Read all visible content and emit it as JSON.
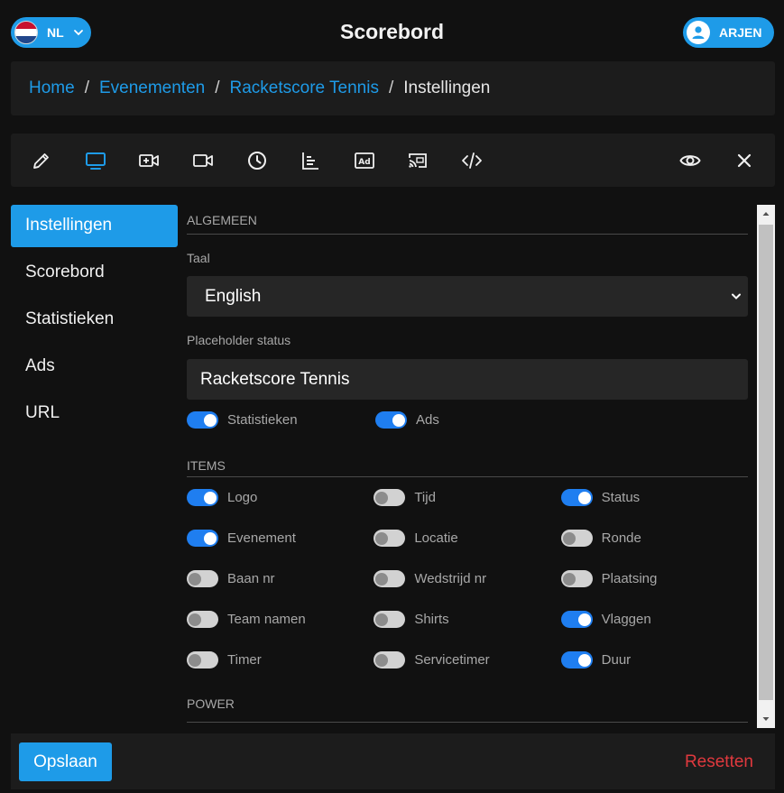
{
  "header": {
    "language": "NL",
    "title": "Scorebord",
    "user": "ARJEN"
  },
  "breadcrumb": {
    "items": [
      "Home",
      "Evenementen",
      "Racketscore Tennis"
    ],
    "current": "Instellingen",
    "separator": "/"
  },
  "toolbar": {
    "icons": [
      "pencil-icon",
      "monitor-icon",
      "video-add-icon",
      "video-icon",
      "clock-icon",
      "bar-chart-icon",
      "ad-icon",
      "cast-icon",
      "code-icon",
      "eye-icon",
      "close-icon"
    ],
    "active": "monitor-icon"
  },
  "sidenav": {
    "items": [
      "Instellingen",
      "Scorebord",
      "Statistieken",
      "Ads",
      "URL"
    ],
    "active": "Instellingen"
  },
  "settings": {
    "general_heading": "ALGEMEEN",
    "language_label": "Taal",
    "language_value": "English",
    "placeholder_label": "Placeholder status",
    "placeholder_value": "Racketscore Tennis",
    "general_toggles": [
      {
        "label": "Statistieken",
        "on": true
      },
      {
        "label": "Ads",
        "on": true
      }
    ],
    "items_heading": "ITEMS",
    "item_toggles": [
      {
        "label": "Logo",
        "on": true
      },
      {
        "label": "Tijd",
        "on": false
      },
      {
        "label": "Status",
        "on": true
      },
      {
        "label": "Evenement",
        "on": true
      },
      {
        "label": "Locatie",
        "on": false
      },
      {
        "label": "Ronde",
        "on": false
      },
      {
        "label": "Baan nr",
        "on": false
      },
      {
        "label": "Wedstrijd nr",
        "on": false
      },
      {
        "label": "Plaatsing",
        "on": false
      },
      {
        "label": "Team namen",
        "on": false
      },
      {
        "label": "Shirts",
        "on": false
      },
      {
        "label": "Vlaggen",
        "on": true
      },
      {
        "label": "Timer",
        "on": false
      },
      {
        "label": "Servicetimer",
        "on": false
      },
      {
        "label": "Duur",
        "on": true
      }
    ],
    "power_heading": "POWER"
  },
  "footer": {
    "save": "Opslaan",
    "reset": "Resetten"
  },
  "colors": {
    "accent": "#1e9be8",
    "toggle_on": "#1f7ef0",
    "danger": "#e0393e",
    "background": "#111111",
    "panel": "#1c1c1c"
  }
}
